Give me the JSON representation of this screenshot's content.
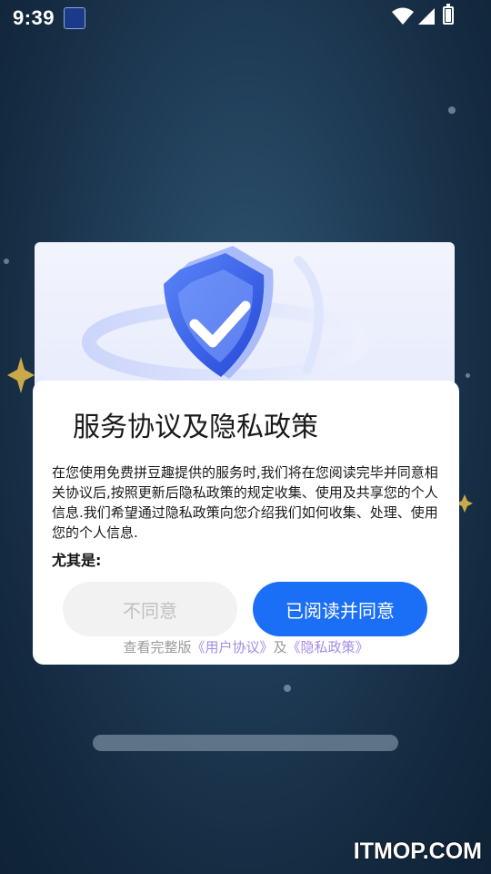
{
  "status_bar": {
    "time": "9:39"
  },
  "dialog": {
    "title": "服务协议及隐私政策",
    "body": "在您使用免费拼豆趣提供的服务时,我们将在您阅读完毕并同意相关协议后,按照更新后隐私政策的规定收集、使用及共享您的个人信息.我们希望通过隐私政策向您介绍我们如何收集、处理、使用您的个人信息.",
    "emphasis": "尤其是:",
    "disagree_label": "不同意",
    "agree_label": "已阅读并同意",
    "links": {
      "prefix": "查看完整版",
      "user_agreement": "《用户协议》",
      "conjunction": "及",
      "privacy_policy": "《隐私政策》"
    }
  },
  "watermark": "ITMOP.COM",
  "colors": {
    "accent": "#1b6ff7",
    "link": "#a48be6",
    "disabled_button": "#f2f2f2"
  }
}
